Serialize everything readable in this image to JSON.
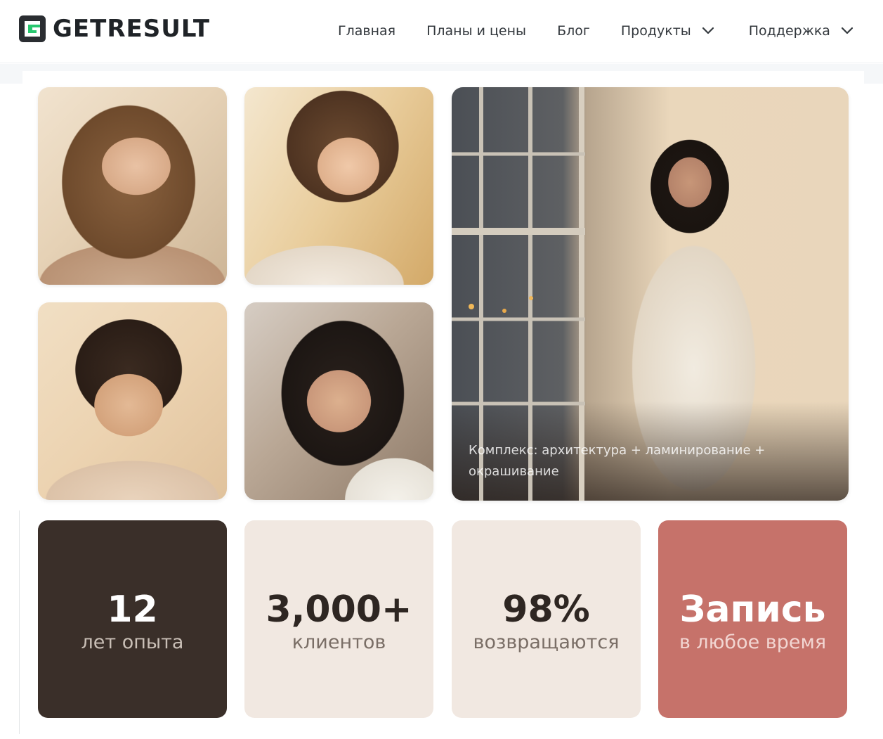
{
  "brand": {
    "name": "GETRESULT",
    "logo_icon": "getresult-logo-icon"
  },
  "nav": {
    "items": [
      {
        "label": "Главная",
        "has_dropdown": false
      },
      {
        "label": "Планы и цены",
        "has_dropdown": false
      },
      {
        "label": "Блог",
        "has_dropdown": false
      },
      {
        "label": "Продукты",
        "has_dropdown": true,
        "icon": "chevron-down-icon"
      },
      {
        "label": "Поддержка",
        "has_dropdown": true,
        "icon": "chevron-down-icon"
      }
    ]
  },
  "gallery": {
    "featured_caption": "Комплекс: архитектура + ламинирование + окрашивание"
  },
  "stats": [
    {
      "value": "12",
      "label": "лет опыта",
      "bg": "#3a2f29"
    },
    {
      "value": "3,000+",
      "label": "клиентов",
      "bg": "#f1e8e1"
    },
    {
      "value": "98%",
      "label": "возвращаются",
      "bg": "#f1e8e1"
    },
    {
      "value": "Запись",
      "label": "в любое время",
      "bg": "#c6726a"
    }
  ]
}
